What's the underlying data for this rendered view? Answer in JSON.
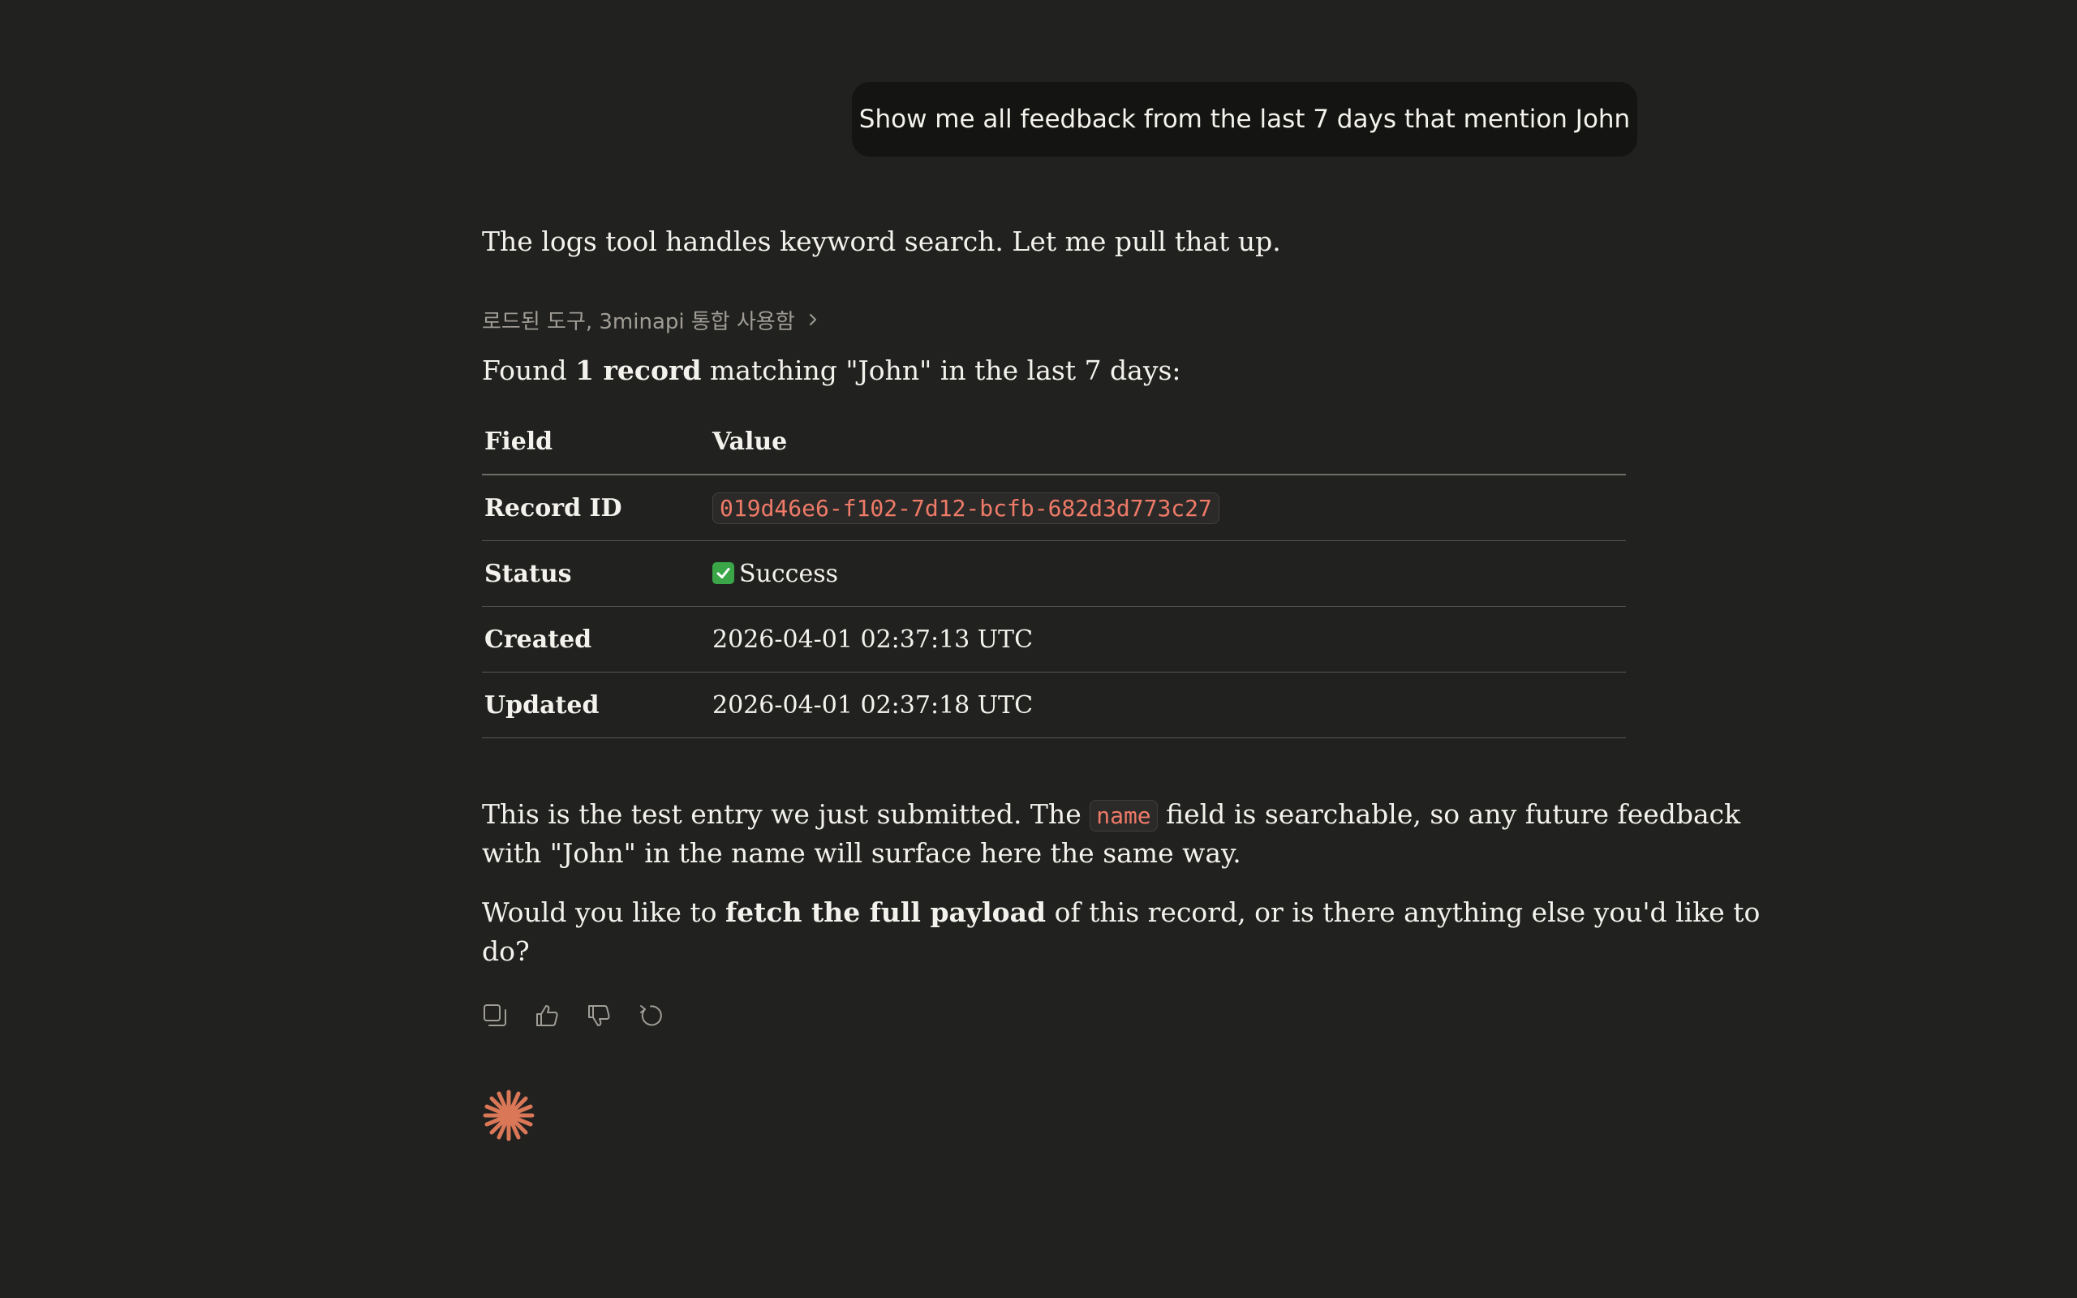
{
  "user_message": "Show me all feedback from the last 7 days that mention John",
  "assistant": {
    "intro": "The logs tool handles keyword search. Let me pull that up.",
    "tool_summary": "로드된 도구, 3minapi 통합 사용함",
    "found": {
      "prefix": "Found ",
      "count": "1 record",
      "suffix": " matching \"John\" in the last 7 days:"
    },
    "table": {
      "headers": [
        "Field",
        "Value"
      ],
      "rows": [
        {
          "field": "Record ID",
          "value": "019d46e6-f102-7d12-bcfb-682d3d773c27"
        },
        {
          "field": "Status",
          "value": "Success"
        },
        {
          "field": "Created",
          "value": "2026-04-01 02:37:13 UTC"
        },
        {
          "field": "Updated",
          "value": "2026-04-01 02:37:18 UTC"
        }
      ]
    },
    "para1": {
      "part1": "This is the test entry we just submitted. The ",
      "code": "name",
      "part2": " field is searchable, so any future feedback",
      "line2": "with \"John\" in the name will surface here the same way."
    },
    "para2": {
      "part1": "Would you like to ",
      "bold": "fetch the full payload",
      "part2": " of this record, or is there anything else you'd like to",
      "line2": "do?"
    },
    "actions": [
      "copy-icon",
      "thumbs-up-icon",
      "thumbs-down-icon",
      "retry-icon"
    ]
  },
  "colors": {
    "background": "#212120",
    "user_bubble": "#141413",
    "code_text": "#ee7a68",
    "accent_spark": "#d97757",
    "success": "#3aa648"
  }
}
